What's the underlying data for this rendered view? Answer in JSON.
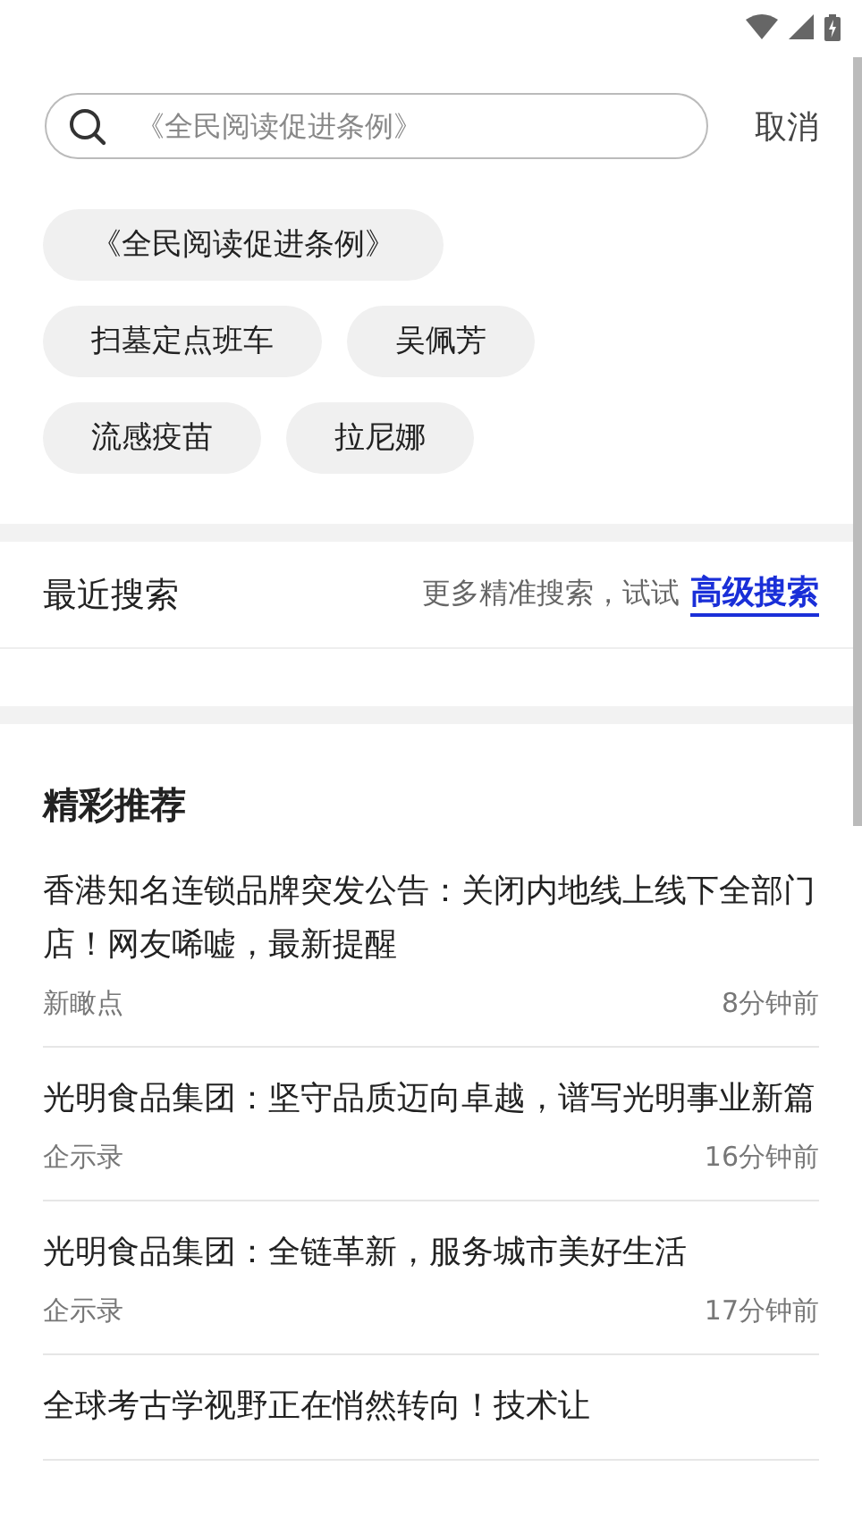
{
  "search": {
    "placeholder": "《全民阅读促进条例》",
    "cancel": "取消"
  },
  "hot_tags": [
    "《全民阅读促进条例》",
    "扫墓定点班车",
    "吴佩芳",
    "流感疫苗",
    "拉尼娜"
  ],
  "recent": {
    "title": "最近搜索",
    "hint": "更多精准搜索，试试",
    "link": "高级搜索"
  },
  "recommend": {
    "title": "精彩推荐",
    "articles": [
      {
        "title": "香港知名连锁品牌突发公告：关闭内地线上线下全部门店！网友唏嘘，最新提醒",
        "source": "新瞰点",
        "time": "8分钟前"
      },
      {
        "title": "光明食品集团：坚守品质迈向卓越，谱写光明事业新篇",
        "source": "企示录",
        "time": "16分钟前"
      },
      {
        "title": "光明食品集团：全链革新，服务城市美好生活",
        "source": "企示录",
        "time": "17分钟前"
      },
      {
        "title": "全球考古学视野正在悄然转向！技术让"
      }
    ]
  }
}
